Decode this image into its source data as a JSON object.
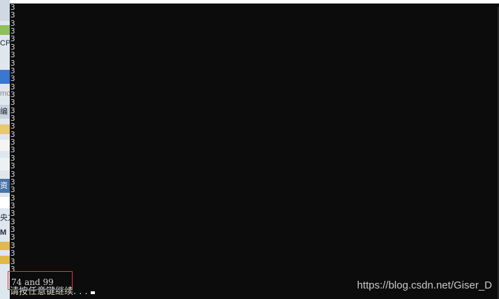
{
  "background_window": {
    "fragments": [
      "CP",
      "mod",
      "编",
      "资",
      "央方",
      "M"
    ]
  },
  "console": {
    "output_line": "3",
    "line_count": 34,
    "result_text": "74 and 99",
    "prompt_text": "请按任意键继续. . ."
  },
  "watermark": "https://blog.csdn.net/Giser_D",
  "colors": {
    "console_background": "#0c0c0c",
    "console_text": "#d8d8d8",
    "highlight_border": "#e3363b",
    "watermark_text": "#c9c9c9"
  }
}
